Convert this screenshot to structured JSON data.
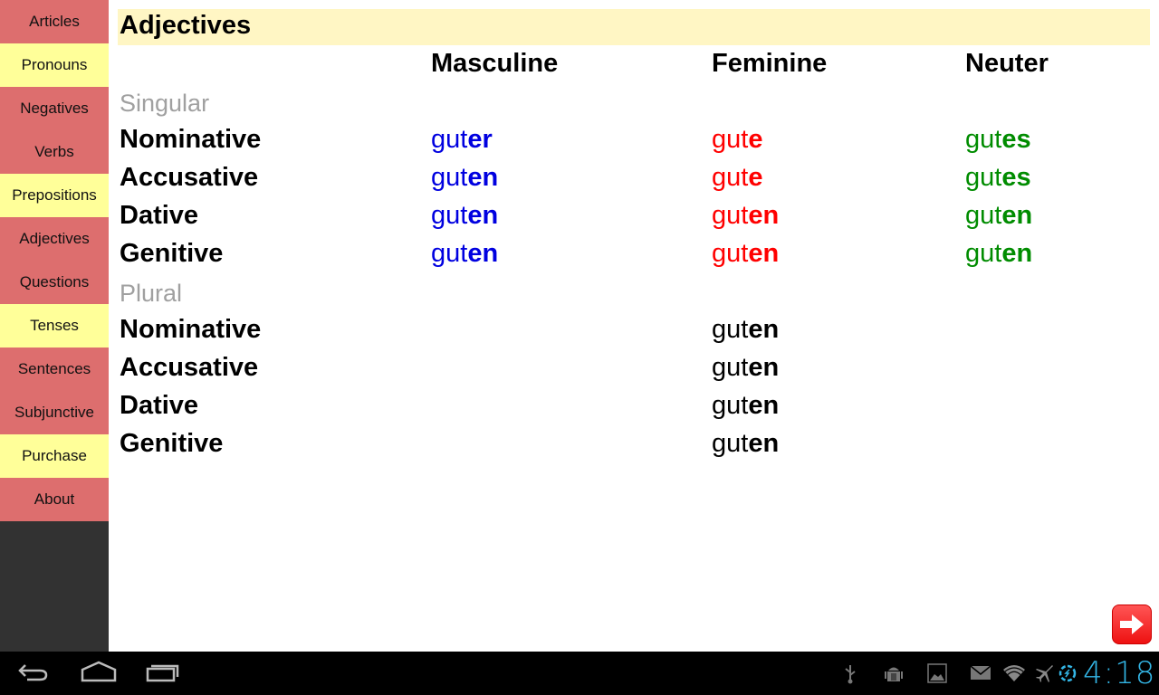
{
  "sidebar": {
    "items": [
      {
        "label": "Articles",
        "color": "red"
      },
      {
        "label": "Pronouns",
        "color": "yellow"
      },
      {
        "label": "Negatives",
        "color": "red"
      },
      {
        "label": "Verbs",
        "color": "red"
      },
      {
        "label": "Prepositions",
        "color": "yellow"
      },
      {
        "label": "Adjectives",
        "color": "red"
      },
      {
        "label": "Questions",
        "color": "red"
      },
      {
        "label": "Tenses",
        "color": "yellow"
      },
      {
        "label": "Sentences",
        "color": "red"
      },
      {
        "label": "Subjunctive",
        "color": "red"
      },
      {
        "label": "Purchase",
        "color": "yellow"
      },
      {
        "label": "About",
        "color": "red"
      }
    ]
  },
  "colors": {
    "nav_red": "#dd6e6e",
    "nav_yellow": "#ffff99",
    "title_bg": "#fff6c4",
    "masculine": "#0000e0",
    "feminine": "#ff0000",
    "neuter": "#008c00",
    "section": "#a0a0a0",
    "clock": "#33b5e5"
  },
  "main": {
    "title": "Adjectives",
    "columns": [
      "Masculine",
      "Feminine",
      "Neuter"
    ],
    "singular": {
      "label": "Singular",
      "rows": [
        {
          "case": "Nominative",
          "masc": {
            "stem": "gut",
            "ending": "er"
          },
          "fem": {
            "stem": "gut",
            "ending": "e"
          },
          "neut": {
            "stem": "gut",
            "ending": "es"
          }
        },
        {
          "case": "Accusative",
          "masc": {
            "stem": "gut",
            "ending": "en"
          },
          "fem": {
            "stem": "gut",
            "ending": "e"
          },
          "neut": {
            "stem": "gut",
            "ending": "es"
          }
        },
        {
          "case": "Dative",
          "masc": {
            "stem": "gut",
            "ending": "en"
          },
          "fem": {
            "stem": "gut",
            "ending": "en"
          },
          "neut": {
            "stem": "gut",
            "ending": "en"
          }
        },
        {
          "case": "Genitive",
          "masc": {
            "stem": "gut",
            "ending": "en"
          },
          "fem": {
            "stem": "gut",
            "ending": "en"
          },
          "neut": {
            "stem": "gut",
            "ending": "en"
          }
        }
      ]
    },
    "plural": {
      "label": "Plural",
      "rows": [
        {
          "case": "Nominative",
          "form": {
            "stem": "gut",
            "ending": "en"
          }
        },
        {
          "case": "Accusative",
          "form": {
            "stem": "gut",
            "ending": "en"
          }
        },
        {
          "case": "Dative",
          "form": {
            "stem": "gut",
            "ending": "en"
          }
        },
        {
          "case": "Genitive",
          "form": {
            "stem": "gut",
            "ending": "en"
          }
        }
      ]
    },
    "next_button_icon": "arrow-right-icon"
  },
  "system_bar": {
    "nav_buttons": [
      "back-icon",
      "home-icon",
      "recent-apps-icon"
    ],
    "status_icons": [
      "usb-icon",
      "android-debug-icon",
      "image-icon",
      "mail-icon",
      "wifi-icon",
      "airplane-icon",
      "sync-icon"
    ],
    "clock": "4:18"
  }
}
